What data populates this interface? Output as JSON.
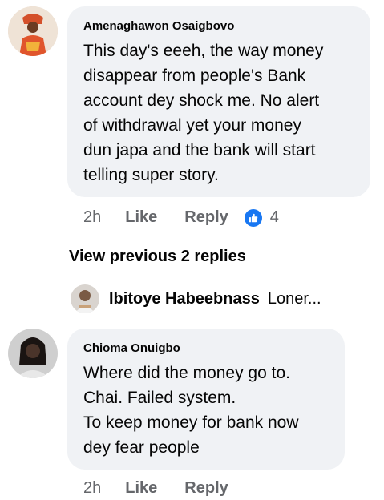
{
  "comment1": {
    "author": "Amenaghawon Osaigbovo",
    "text_lines": [
      "This day's eeeh, the way money",
      "disappear from people's Bank",
      "account dey shock me. No alert",
      "of withdrawal yet your money",
      "dun japa and the bank will start",
      "telling super story."
    ],
    "time": "2h",
    "like_label": "Like",
    "reply_label": "Reply",
    "reaction_icon": "thumbs-up-icon",
    "reaction_count": "4"
  },
  "view_previous": "View previous 2 replies",
  "reply_preview": {
    "author": "Ibitoye Habeebnass",
    "text": "Loner..."
  },
  "comment2": {
    "author": "Chioma Onuigbo",
    "text_lines": [
      "Where did the money go to.",
      "Chai. Failed system.",
      "To keep money for bank now",
      "dey fear people"
    ],
    "time": "2h",
    "like_label": "Like",
    "reply_label": "Reply"
  },
  "colors": {
    "bubble": "#f0f2f5",
    "meta": "#65676b",
    "like_blue": "#1877f2"
  }
}
